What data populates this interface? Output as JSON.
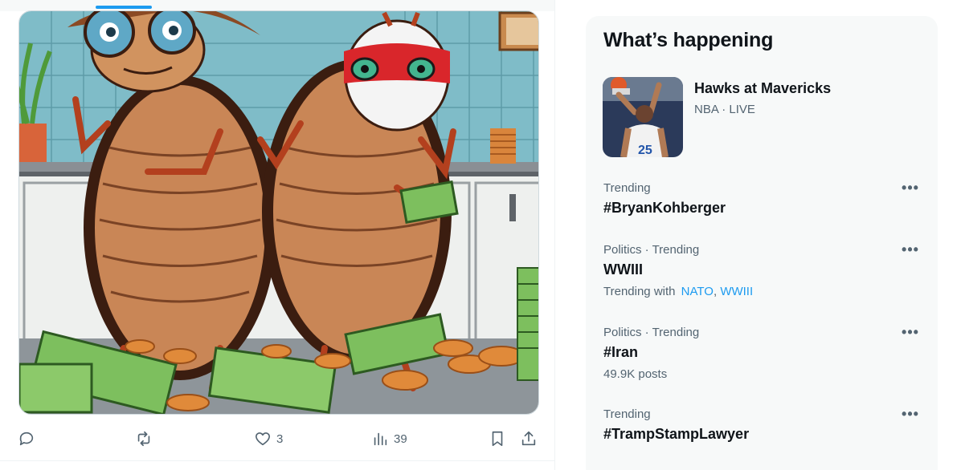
{
  "post": {
    "image_icon": "cartoon-cockroaches-with-money-image",
    "actions": {
      "reply": {
        "icon": "reply-icon",
        "count": ""
      },
      "retweet": {
        "icon": "retweet-icon",
        "count": ""
      },
      "like": {
        "icon": "heart-icon",
        "count": "3"
      },
      "views": {
        "icon": "views-chart-icon",
        "count": "39"
      },
      "bookmark": {
        "icon": "bookmark-icon"
      },
      "share": {
        "icon": "share-icon"
      }
    }
  },
  "sidebar": {
    "title": "What’s happening",
    "event": {
      "name": "Hawks at Mavericks",
      "league": "NBA",
      "separator": "·",
      "status": "LIVE",
      "thumb_icon": "basketball-player-thumbnail"
    },
    "trends": [
      {
        "context": "Trending",
        "name": "#BryanKohberger"
      },
      {
        "context": "Politics · Trending",
        "name": "WWIII",
        "trending_with_label": "Trending with",
        "links": [
          "NATO",
          "WWIII"
        ]
      },
      {
        "context": "Politics · Trending",
        "name": "#Iran",
        "posts": "49.9K posts"
      },
      {
        "context": "Trending",
        "name": "#TrampStampLawyer"
      }
    ],
    "more_label": "•••"
  },
  "colors": {
    "accent": "#1d9bf0",
    "text_primary": "#0f1419",
    "text_secondary": "#536471",
    "panel_bg": "#f7f9f9"
  }
}
